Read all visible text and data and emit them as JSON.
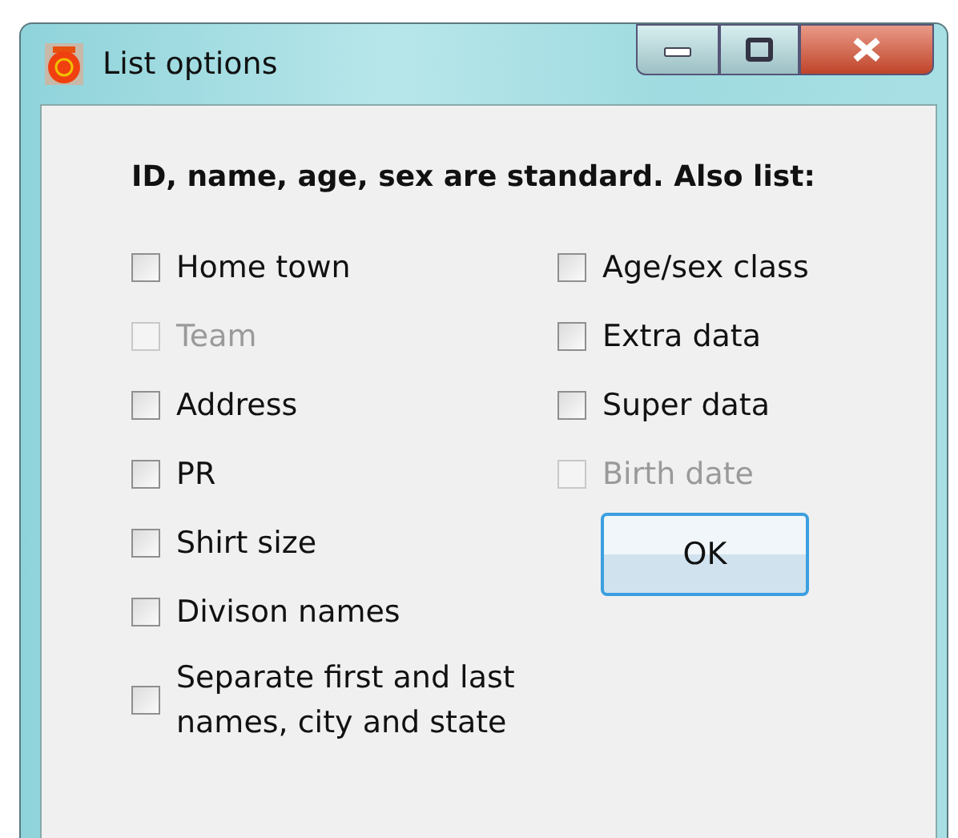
{
  "window": {
    "title": "List options"
  },
  "heading": "ID, name, age, sex are standard. Also list:",
  "left_options": [
    {
      "label": "Home town",
      "checked": false,
      "disabled": false
    },
    {
      "label": "Team",
      "checked": false,
      "disabled": true
    },
    {
      "label": "Address",
      "checked": false,
      "disabled": false
    },
    {
      "label": "PR",
      "checked": false,
      "disabled": false
    },
    {
      "label": "Shirt size",
      "checked": false,
      "disabled": false
    },
    {
      "label": "Divison names",
      "checked": false,
      "disabled": false
    }
  ],
  "right_options": [
    {
      "label": "Age/sex class",
      "checked": false,
      "disabled": false
    },
    {
      "label": "Extra data",
      "checked": false,
      "disabled": false
    },
    {
      "label": "Super data",
      "checked": false,
      "disabled": false
    },
    {
      "label": "Birth date",
      "checked": false,
      "disabled": true
    }
  ],
  "ok_button": "OK",
  "separate_option": {
    "label": "Separate first and last names, city and state",
    "checked": false,
    "disabled": false
  }
}
